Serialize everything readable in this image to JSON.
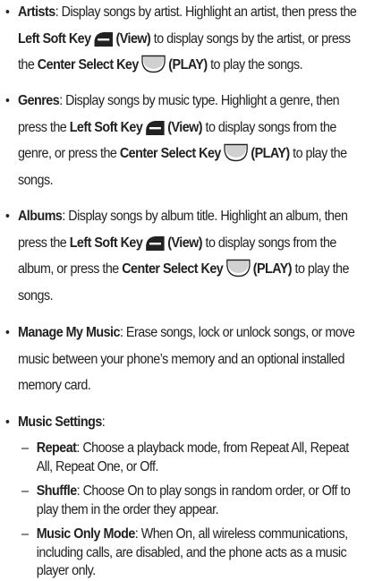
{
  "keys": {
    "left_soft_key": "Left Soft Key",
    "view": "(View)",
    "center_select_key": "Center Select Key",
    "play": "(PLAY)",
    "icons": [
      "left-soft-key-icon",
      "center-select-key-icon"
    ]
  },
  "items": {
    "artists": {
      "term": "Artists",
      "t1": ": Display songs by artist. Highlight an artist, then press the ",
      "t2": " to display songs by the artist, or press the ",
      "t3": " to play the songs."
    },
    "genres": {
      "term": "Genres",
      "t1": ": Display songs by music type. Highlight a genre, then press the ",
      "t2": " to display songs from the genre, or press the ",
      "t3": " to play the songs."
    },
    "albums": {
      "term": "Albums",
      "t1": ": Display songs by album title. Highlight an album, then press the ",
      "t2": " to display songs from the album, or press the ",
      "t3": " to play the songs."
    },
    "manage": {
      "term": "Manage My Music",
      "t1": ": Erase songs, lock or unlock songs, or move music between your phone’s memory and an optional installed memory card."
    },
    "settings": {
      "term": "Music Settings",
      "t1": ":"
    }
  },
  "sub_items": {
    "repeat": {
      "term": "Repeat",
      "t1": ": Choose a playback mode, from Repeat All, Repeat All, Repeat One, or Off."
    },
    "shuffle": {
      "term": "Shuffle",
      "t1": ": Choose On to play songs in random order, or Off to play them in the order they appear."
    },
    "music_only": {
      "term": "Music Only Mode",
      "t1": ": When On, all wireless communications, including calls, are disabled, and the phone acts as a music player only."
    }
  },
  "bullet_char": "•",
  "dash_char": "–"
}
